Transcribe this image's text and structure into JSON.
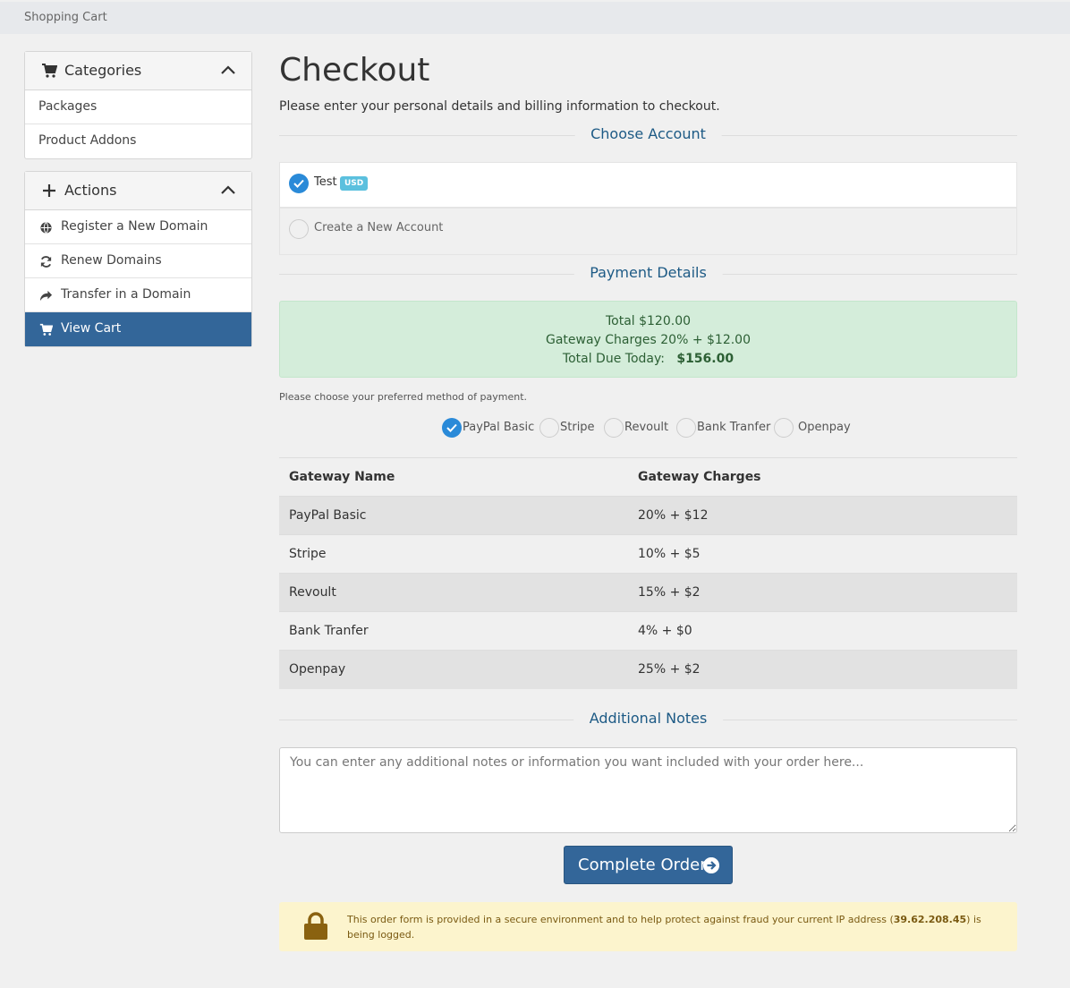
{
  "breadcrumb": "Shopping Cart",
  "sidebar": {
    "categories": {
      "title": "Categories",
      "items": [
        "Packages",
        "Product Addons"
      ]
    },
    "actions": {
      "title": "Actions",
      "items": [
        {
          "label": "Register a New Domain",
          "icon": "globe-icon"
        },
        {
          "label": "Renew Domains",
          "icon": "refresh-icon"
        },
        {
          "label": "Transfer in a Domain",
          "icon": "share-icon"
        },
        {
          "label": "View Cart",
          "icon": "cart-icon",
          "active": true
        }
      ]
    }
  },
  "page": {
    "title": "Checkout",
    "intro": "Please enter your personal details and billing information to checkout."
  },
  "choose_account": {
    "heading": "Choose Account",
    "accounts": [
      {
        "label": "Test",
        "badge": "USD",
        "selected": true
      },
      {
        "label": "Create a New Account",
        "selected": false
      }
    ]
  },
  "payment": {
    "heading": "Payment Details",
    "total_line": "Total $120.00",
    "charges_line": "Gateway Charges 20% + $12.00",
    "due_label": "Total Due Today:",
    "due_value": "$156.00",
    "method_prompt": "Please choose your preferred method of payment.",
    "methods": [
      {
        "label": "PayPal Basic",
        "selected": true
      },
      {
        "label": "Stripe",
        "selected": false
      },
      {
        "label": "Revoult",
        "selected": false
      },
      {
        "label": "Bank Tranfer",
        "selected": false
      },
      {
        "label": "Openpay",
        "selected": false
      }
    ]
  },
  "gateway_table": {
    "headers": [
      "Gateway Name",
      "Gateway Charges"
    ],
    "rows": [
      [
        "PayPal Basic",
        "20% + $12"
      ],
      [
        "Stripe",
        "10% + $5"
      ],
      [
        "Revoult",
        "15% + $2"
      ],
      [
        "Bank Tranfer",
        "4% + $0"
      ],
      [
        "Openpay",
        "25% + $2"
      ]
    ]
  },
  "notes": {
    "heading": "Additional Notes",
    "placeholder": "You can enter any additional notes or information you want included with your order here..."
  },
  "complete_button": "Complete Order",
  "secure_notice": {
    "before": "This order form is provided in a secure environment and to help protect against fraud your current IP address (",
    "ip": "39.62.208.45",
    "after": ") is being logged."
  },
  "colors": {
    "primary": "#336699",
    "heading_blue": "#1d5a85",
    "success_bg": "#d4edda",
    "warning_bg": "#fcf4cd",
    "check_blue": "#2a8ad8"
  }
}
